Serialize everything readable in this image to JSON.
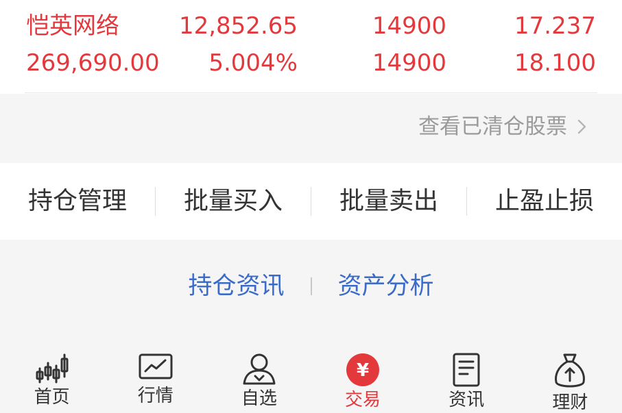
{
  "holding": {
    "row1": [
      "恺英网络",
      "12,852.65",
      "14900",
      "17.237"
    ],
    "row2": [
      "269,690.00",
      "5.004%",
      "14900",
      "18.100"
    ]
  },
  "cleared_link": {
    "label": "查看已清仓股票"
  },
  "actions": [
    "持仓管理",
    "批量买入",
    "批量卖出",
    "止盈止损"
  ],
  "subtabs": [
    "持仓资讯",
    "资产分析"
  ],
  "tabbar": {
    "items": [
      {
        "label": "首页",
        "icon": "candlestick-icon"
      },
      {
        "label": "行情",
        "icon": "chart-monitor-icon"
      },
      {
        "label": "自选",
        "icon": "user-icon"
      },
      {
        "label": "交易",
        "icon": "yen-circle-icon",
        "active": true
      },
      {
        "label": "资讯",
        "icon": "document-icon"
      },
      {
        "label": "理财",
        "icon": "money-bag-icon"
      }
    ]
  },
  "colors": {
    "up_red": "#e4393c",
    "link_blue": "#3a6bc9",
    "muted_gray": "#9b9b9b",
    "text_dark": "#333333",
    "page_bg": "#f5f5f5"
  }
}
